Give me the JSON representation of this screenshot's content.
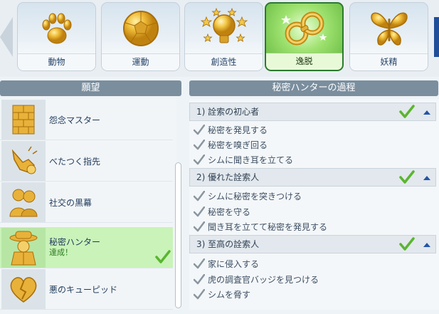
{
  "categories": [
    {
      "label": "動物",
      "icon": "paw-icon"
    },
    {
      "label": "運動",
      "icon": "soccer-ball-icon"
    },
    {
      "label": "創造性",
      "icon": "lightbulb-icon"
    },
    {
      "label": "逸脱",
      "icon": "handcuffs-icon",
      "selected": true
    },
    {
      "label": "妖精",
      "icon": "butterfly-icon"
    }
  ],
  "aspirations_header": "願望",
  "aspirations": [
    {
      "name": "怨念マスター",
      "icon": "wall-icon"
    },
    {
      "name": "べたつく指先",
      "icon": "grabbing-hand-icon"
    },
    {
      "name": "社交の黒幕",
      "icon": "whispering-figures-icon"
    },
    {
      "name": "秘密ハンター",
      "status": "達成！",
      "icon": "detective-icon",
      "selected": true
    },
    {
      "name": "悪のキューピッド",
      "icon": "broken-heart-icon"
    }
  ],
  "milestone_header": "秘密ハンターの過程",
  "stages": [
    {
      "title": "1)  詮索の初心者",
      "goals": [
        "秘密を発見する",
        "秘密を嗅ぎ回る",
        "シムに聞き耳を立てる"
      ]
    },
    {
      "title": "2)  優れた詮索人",
      "goals": [
        "シムに秘密を突きつける",
        "秘密を守る",
        "聞き耳を立てて秘密を発見する"
      ]
    },
    {
      "title": "3)  至高の詮索人",
      "goals": [
        "家に侵入する",
        "虎の調査官バッジを見つける",
        "シムを脅す"
      ]
    }
  ],
  "colors": {
    "accent_green": "#5ab52f",
    "selected_tab_border": "#2b7a2f",
    "header_bg": "#7a8e9e",
    "collapse_arrow": "#2354a8"
  }
}
